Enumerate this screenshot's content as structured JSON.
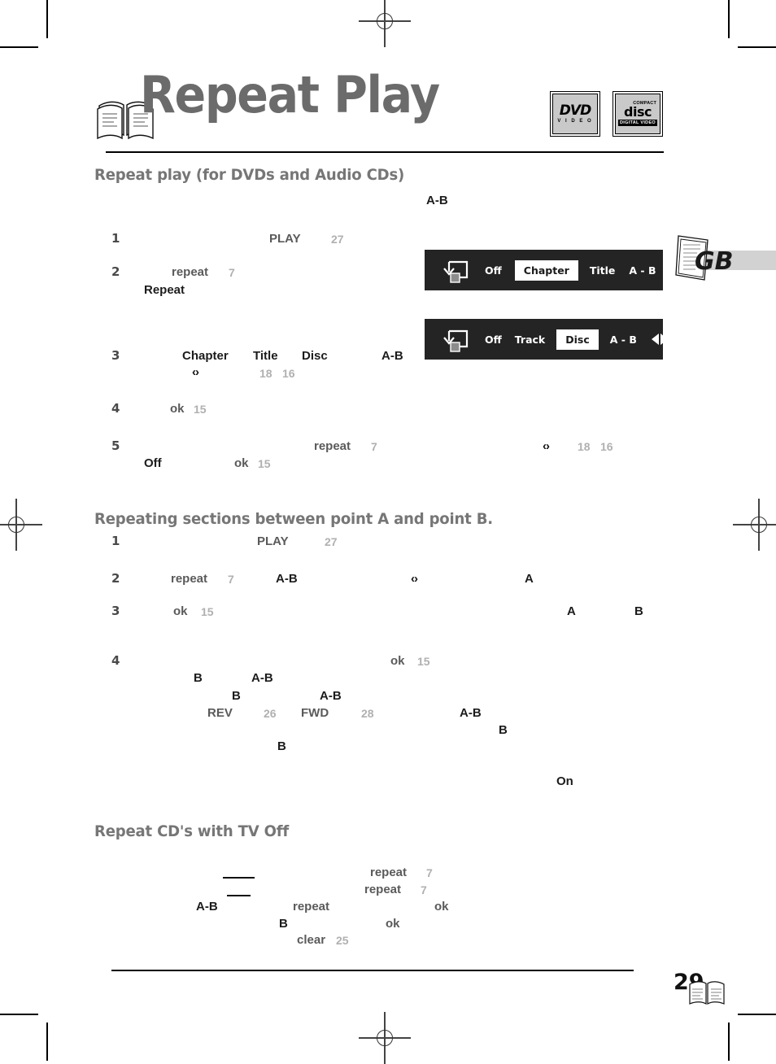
{
  "document": {
    "title": "Repeat Play",
    "page_number": "29",
    "language_tab": "GB"
  },
  "logos": {
    "dvd": {
      "word": "DVD",
      "sub": "V I D E O"
    },
    "cd": {
      "compact": "COMPACT",
      "word": "disc",
      "sub": "DIGITAL VIDEO"
    }
  },
  "sections": {
    "repeat_play": {
      "heading": "Repeat play (for DVDs and Audio CDs)"
    },
    "ab_repeat": {
      "heading": "Repeating sections between point A and point B."
    },
    "cd_tv_off": {
      "heading": "Repeat CD's with TV Off"
    }
  },
  "osd_bars": [
    {
      "name": "dvd-repeat-bar",
      "icon": "repeat-loop-icon",
      "items": [
        {
          "label": "Off",
          "selected": false
        },
        {
          "label": "Chapter",
          "selected": true
        },
        {
          "label": "Title",
          "selected": false
        },
        {
          "label": "A - B",
          "selected": false
        }
      ],
      "arrows": "left-right-arrows"
    },
    {
      "name": "cd-repeat-bar",
      "icon": "repeat-loop-icon",
      "items": [
        {
          "label": "Off",
          "selected": false
        },
        {
          "label": "Track",
          "selected": false
        },
        {
          "label": "Disc",
          "selected": true
        },
        {
          "label": "A - B",
          "selected": false
        }
      ],
      "arrows": "left-right-arrows"
    }
  ],
  "fragments": {
    "ab_top": "A-B",
    "s1_num": "1",
    "s1_play": "PLAY",
    "s1_ref": "27",
    "s2_num": "2",
    "s2_repeat": "repeat",
    "s2_ref": "7",
    "s2_word": "Repeat",
    "s3_num": "3",
    "s3_chapter": "Chapter",
    "s3_title": "Title",
    "s3_disc": "Disc",
    "s3_ab": "A-B",
    "s3_arrows": "‹›",
    "s3_ref1": "18",
    "s3_ref2": "16",
    "s4_num": "4",
    "s4_ok": "ok",
    "s4_ref": "15",
    "s5_num": "5",
    "s5_repeat": "repeat",
    "s5_ref": "7",
    "s5_arrows": "‹›",
    "s5_ref1": "18",
    "s5_ref2": "16",
    "s5_off": "Off",
    "s5_ok": "ok",
    "s5_okref": "15",
    "b1_num": "1",
    "b1_play": "PLAY",
    "b1_ref": "27",
    "b2_num": "2",
    "b2_repeat": "repeat",
    "b2_ref": "7",
    "b2_ab": "A-B",
    "b2_arrows": "‹›",
    "b2_a": "A",
    "b3_num": "3",
    "b3_ok": "ok",
    "b3_ref": "15",
    "b3_a": "A",
    "b3_b": "B",
    "b4_num": "4",
    "b4_ok": "ok",
    "b4_ref": "15",
    "b4_b1": "B",
    "b4_ab1": "A-B",
    "b4_b2": "B",
    "b4_ab2": "A-B",
    "b4_rev": "REV",
    "b4_revref": "26",
    "b4_fwd": "FWD",
    "b4_fwdref": "28",
    "b4_ab3": "A-B",
    "b4_b3": "B",
    "b4_b4": "B",
    "b4_on": "On",
    "c1_repeat": "repeat",
    "c1_ref": "7",
    "c2_repeat": "repeat",
    "c2_ref": "7",
    "c3_ab": "A-B",
    "c3_repeat": "repeat",
    "c3_ok": "ok",
    "c4_b": "B",
    "c4_ok": "ok",
    "c5_clear": "clear",
    "c5_ref": "25"
  },
  "colors": {
    "heading_gray": "#767676",
    "title_gray": "#6b6b6b",
    "page_ref_gray": "#b0b0b0",
    "osd_background": "#242424",
    "gb_bar_gray": "#d2d2d2"
  }
}
